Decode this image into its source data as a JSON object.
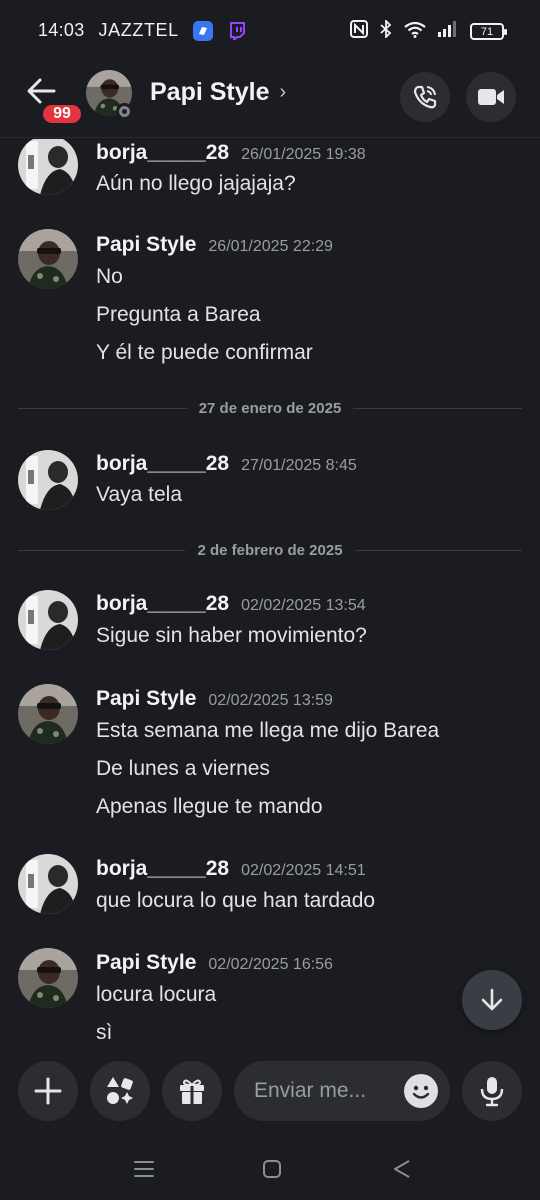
{
  "status_bar": {
    "time": "14:03",
    "carrier": "JAZZTEL",
    "battery": "71",
    "icons": [
      "signal-app-icon",
      "twitch-icon",
      "nfc-icon",
      "bluetooth-icon",
      "wifi-icon",
      "cell-signal-icon",
      "battery-icon"
    ]
  },
  "header": {
    "back_badge": "99",
    "title": "Papi Style",
    "chevron": "›",
    "colors": {
      "badge": "#e3343f",
      "button_bg": "#2b2d33"
    }
  },
  "messages": [
    {
      "author": "borja_____28",
      "avatar": "borja",
      "timestamp": "26/01/2025 19:38",
      "lines": [
        "Aún no llego jajajaja?"
      ]
    },
    {
      "author": "Papi Style",
      "avatar": "papi",
      "timestamp": "26/01/2025 22:29",
      "lines": [
        "No",
        "Pregunta a Barea",
        "Y él te puede confirmar"
      ]
    },
    {
      "divider": "27 de enero de 2025"
    },
    {
      "author": "borja_____28",
      "avatar": "borja",
      "timestamp": "27/01/2025 8:45",
      "lines": [
        "Vaya tela"
      ]
    },
    {
      "divider": "2 de febrero de 2025"
    },
    {
      "author": "borja_____28",
      "avatar": "borja",
      "timestamp": "02/02/2025 13:54",
      "lines": [
        "Sigue sin haber movimiento?"
      ]
    },
    {
      "author": "Papi Style",
      "avatar": "papi",
      "timestamp": "02/02/2025 13:59",
      "lines": [
        "Esta semana me llega me dijo Barea",
        "De lunes a viernes",
        "Apenas llegue te mando"
      ]
    },
    {
      "author": "borja_____28",
      "avatar": "borja",
      "timestamp": "02/02/2025 14:51",
      "lines": [
        "que locura lo que han tardado"
      ]
    },
    {
      "author": "Papi Style",
      "avatar": "papi",
      "timestamp": "02/02/2025 16:56",
      "lines": [
        "locura locura",
        "sì"
      ]
    }
  ],
  "composer": {
    "placeholder": "Enviar me...",
    "buttons": [
      "plus-icon",
      "apps-icon",
      "gift-icon",
      "emoji-icon",
      "microphone-icon"
    ]
  },
  "jump_button": "arrow-down-icon",
  "nav": [
    "menu-icon",
    "home-icon",
    "back-triangle-icon"
  ]
}
